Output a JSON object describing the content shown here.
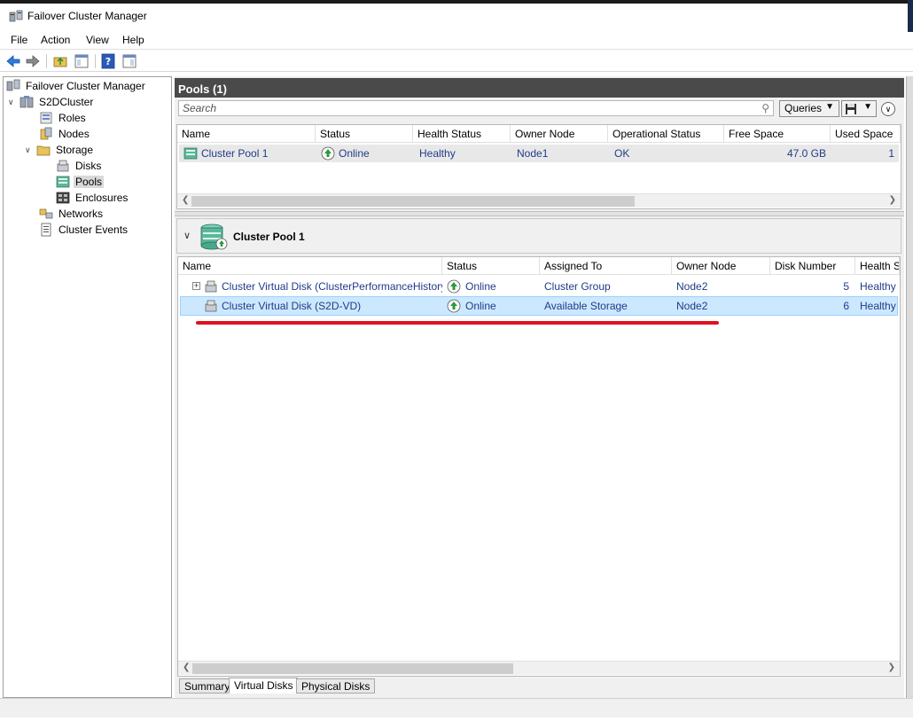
{
  "window": {
    "title": "Failover Cluster Manager"
  },
  "menu": [
    "File",
    "Action",
    "View",
    "Help"
  ],
  "tree": {
    "root": "Failover Cluster Manager",
    "cluster": "S2DCluster",
    "roles": "Roles",
    "nodes": "Nodes",
    "storage": "Storage",
    "disks": "Disks",
    "pools": "Pools",
    "enclosures": "Enclosures",
    "networks": "Networks",
    "events": "Cluster Events"
  },
  "pools_panel": {
    "title": "Pools (1)",
    "search_placeholder": "Search",
    "queries_label": "Queries",
    "columns": [
      "Name",
      "Status",
      "Health Status",
      "Owner Node",
      "Operational Status",
      "Free Space",
      "Used Space"
    ],
    "rows": [
      {
        "name": "Cluster Pool 1",
        "status": "Online",
        "health": "Healthy",
        "owner": "Node1",
        "operational": "OK",
        "free": "47.0 GB",
        "used": "1"
      }
    ]
  },
  "detail": {
    "title": "Cluster Pool 1",
    "columns": [
      "Name",
      "Status",
      "Assigned To",
      "Owner Node",
      "Disk Number",
      "Health St"
    ],
    "rows": [
      {
        "name": "Cluster Virtual Disk (ClusterPerformanceHistory)",
        "status": "Online",
        "assigned": "Cluster Group",
        "owner": "Node2",
        "disk": "5",
        "health": "Healthy",
        "expandable": true,
        "selected": false
      },
      {
        "name": "Cluster Virtual Disk (S2D-VD)",
        "status": "Online",
        "assigned": "Available Storage",
        "owner": "Node2",
        "disk": "6",
        "health": "Healthy",
        "expandable": false,
        "selected": true
      }
    ],
    "tabs": [
      "Summary",
      "Virtual Disks",
      "Physical Disks"
    ],
    "active_tab": "Virtual Disks"
  },
  "colors": {
    "link_blue": "#1f3c88",
    "header_dark": "#4a4a4a",
    "selection": "#cce8ff",
    "annotation_red": "#e01020"
  }
}
